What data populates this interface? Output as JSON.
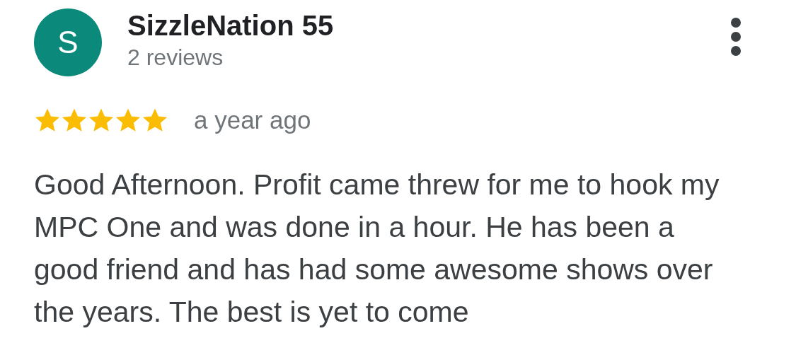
{
  "review": {
    "avatar_letter": "S",
    "author": "SizzleNation 55",
    "author_reviews": "2 reviews",
    "stars": 5,
    "time": "a year ago",
    "text": "Good Afternoon. Profit came threw for me to hook my MPC One and was done in a hour. He has been a good friend and has had some awesome shows over the years. The best is yet to come"
  }
}
